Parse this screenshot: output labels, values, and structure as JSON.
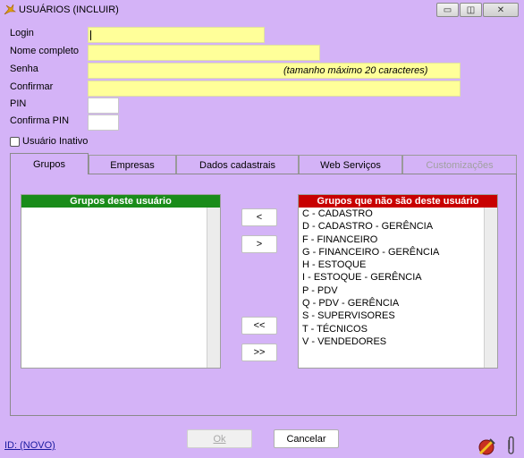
{
  "window": {
    "title": "USUÁRIOS (INCLUIR)",
    "icon": "app-wing-icon",
    "buttons": {
      "minimize": "▭",
      "restore": "◫",
      "close": "✕"
    }
  },
  "form": {
    "login_label": "Login",
    "login_value": "",
    "fullname_label": "Nome completo",
    "fullname_value": "",
    "password_label": "Senha",
    "password_hint": "(tamanho máximo 20 caracteres)",
    "confirm_label": "Confirmar",
    "pin_label": "PIN",
    "confirm_pin_label": "Confirma PIN",
    "inactive_label": "Usuário Inativo",
    "inactive_checked": false
  },
  "tabs": [
    {
      "label": "Grupos",
      "active": true,
      "enabled": true
    },
    {
      "label": "Empresas",
      "active": false,
      "enabled": true
    },
    {
      "label": "Dados cadastrais",
      "active": false,
      "enabled": true
    },
    {
      "label": "Web Serviços",
      "active": false,
      "enabled": true
    },
    {
      "label": "Customizações",
      "active": false,
      "enabled": false
    }
  ],
  "groups": {
    "member_title": "Grupos deste usuário",
    "member_color": "#1a8c1a",
    "member_items": [],
    "nonmember_title": "Grupos que não são deste usuário",
    "nonmember_color": "#c80000",
    "nonmember_items": [
      "C - CADASTRO",
      "D - CADASTRO - GERÊNCIA",
      "F - FINANCEIRO",
      "G - FINANCEIRO - GERÊNCIA",
      "H - ESTOQUE",
      "I - ESTOQUE - GERÊNCIA",
      "P - PDV",
      "Q - PDV - GERÊNCIA",
      "S - SUPERVISORES",
      "T - TÉCNICOS",
      "V - VENDEDORES"
    ],
    "move_left": "<",
    "move_right": ">",
    "move_all_left": "<<",
    "move_all_right": ">>"
  },
  "footer": {
    "ok_label": "Ok",
    "cancel_label": "Cancelar",
    "id_text": "ID: (NOVO)"
  }
}
